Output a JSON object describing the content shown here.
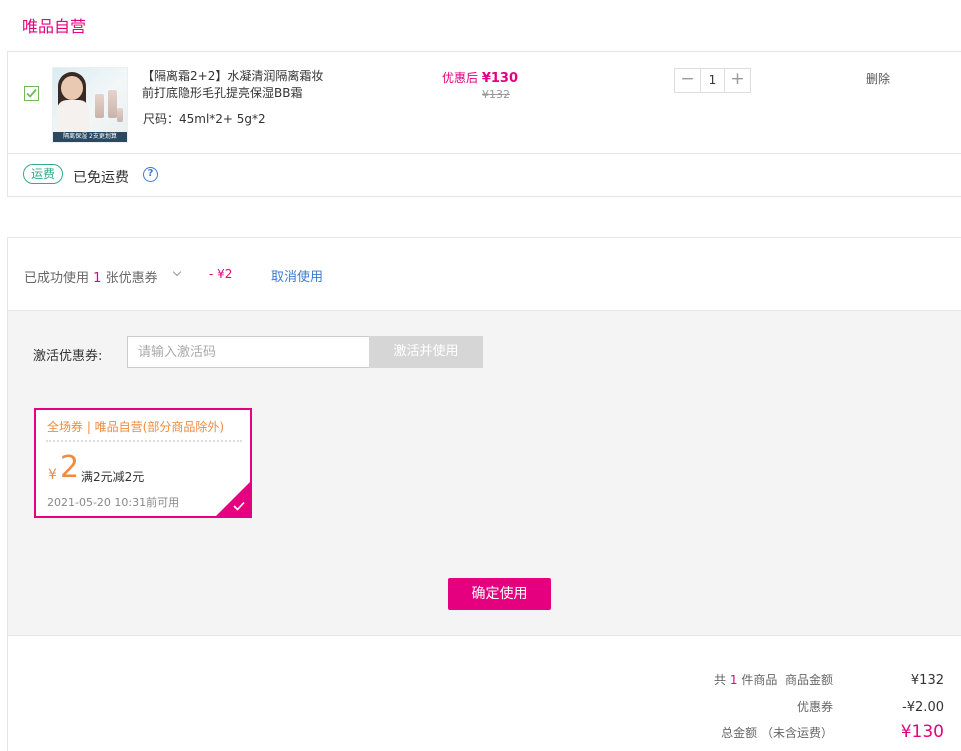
{
  "store": {
    "title": "唯品自营"
  },
  "cart_item": {
    "name": "【隔离霜2+2】水凝清润隔离霜妆前打底隐形毛孔提亮保湿BB霜",
    "spec": "尺码：45ml*2+ 5g*2",
    "image_banner": "隔离保湿 2支更划算",
    "price_label": "优惠后",
    "price_now": "¥130",
    "price_old": "¥132",
    "quantity": "1",
    "minus": "−",
    "plus": "+",
    "delete_label": "删除",
    "checked": true
  },
  "freight": {
    "tag": "运费",
    "text": "已免运费",
    "help": "?"
  },
  "coupon": {
    "used_prefix": "已成功使用",
    "used_count": "1",
    "used_suffix": "张优惠券",
    "discount": "- ¥2",
    "cancel_label": "取消使用",
    "activate_label": "激活优惠券:",
    "activate_placeholder": "请输入激活码",
    "activate_button": "激活并使用",
    "card": {
      "scope": "全场券 | 唯品自营(部分商品除外)",
      "currency": "¥",
      "amount": "2",
      "rule": "满2元减2元",
      "valid": "2021-05-20 10:31前可用",
      "selected": true
    },
    "confirm_button": "确定使用"
  },
  "summary": {
    "count_prefix": "共",
    "count": "1",
    "count_suffix": "件商品",
    "goods_label": "商品金额",
    "goods_value": "¥132",
    "coupon_label": "优惠券",
    "coupon_value": "-¥2.00",
    "total_label": "总金额 （未含运费）",
    "total_value": "¥130"
  },
  "colors": {
    "brand": "#e5007f",
    "freight": "#35a98a",
    "link": "#3a7bd5",
    "coupon": "#f08a3c"
  }
}
